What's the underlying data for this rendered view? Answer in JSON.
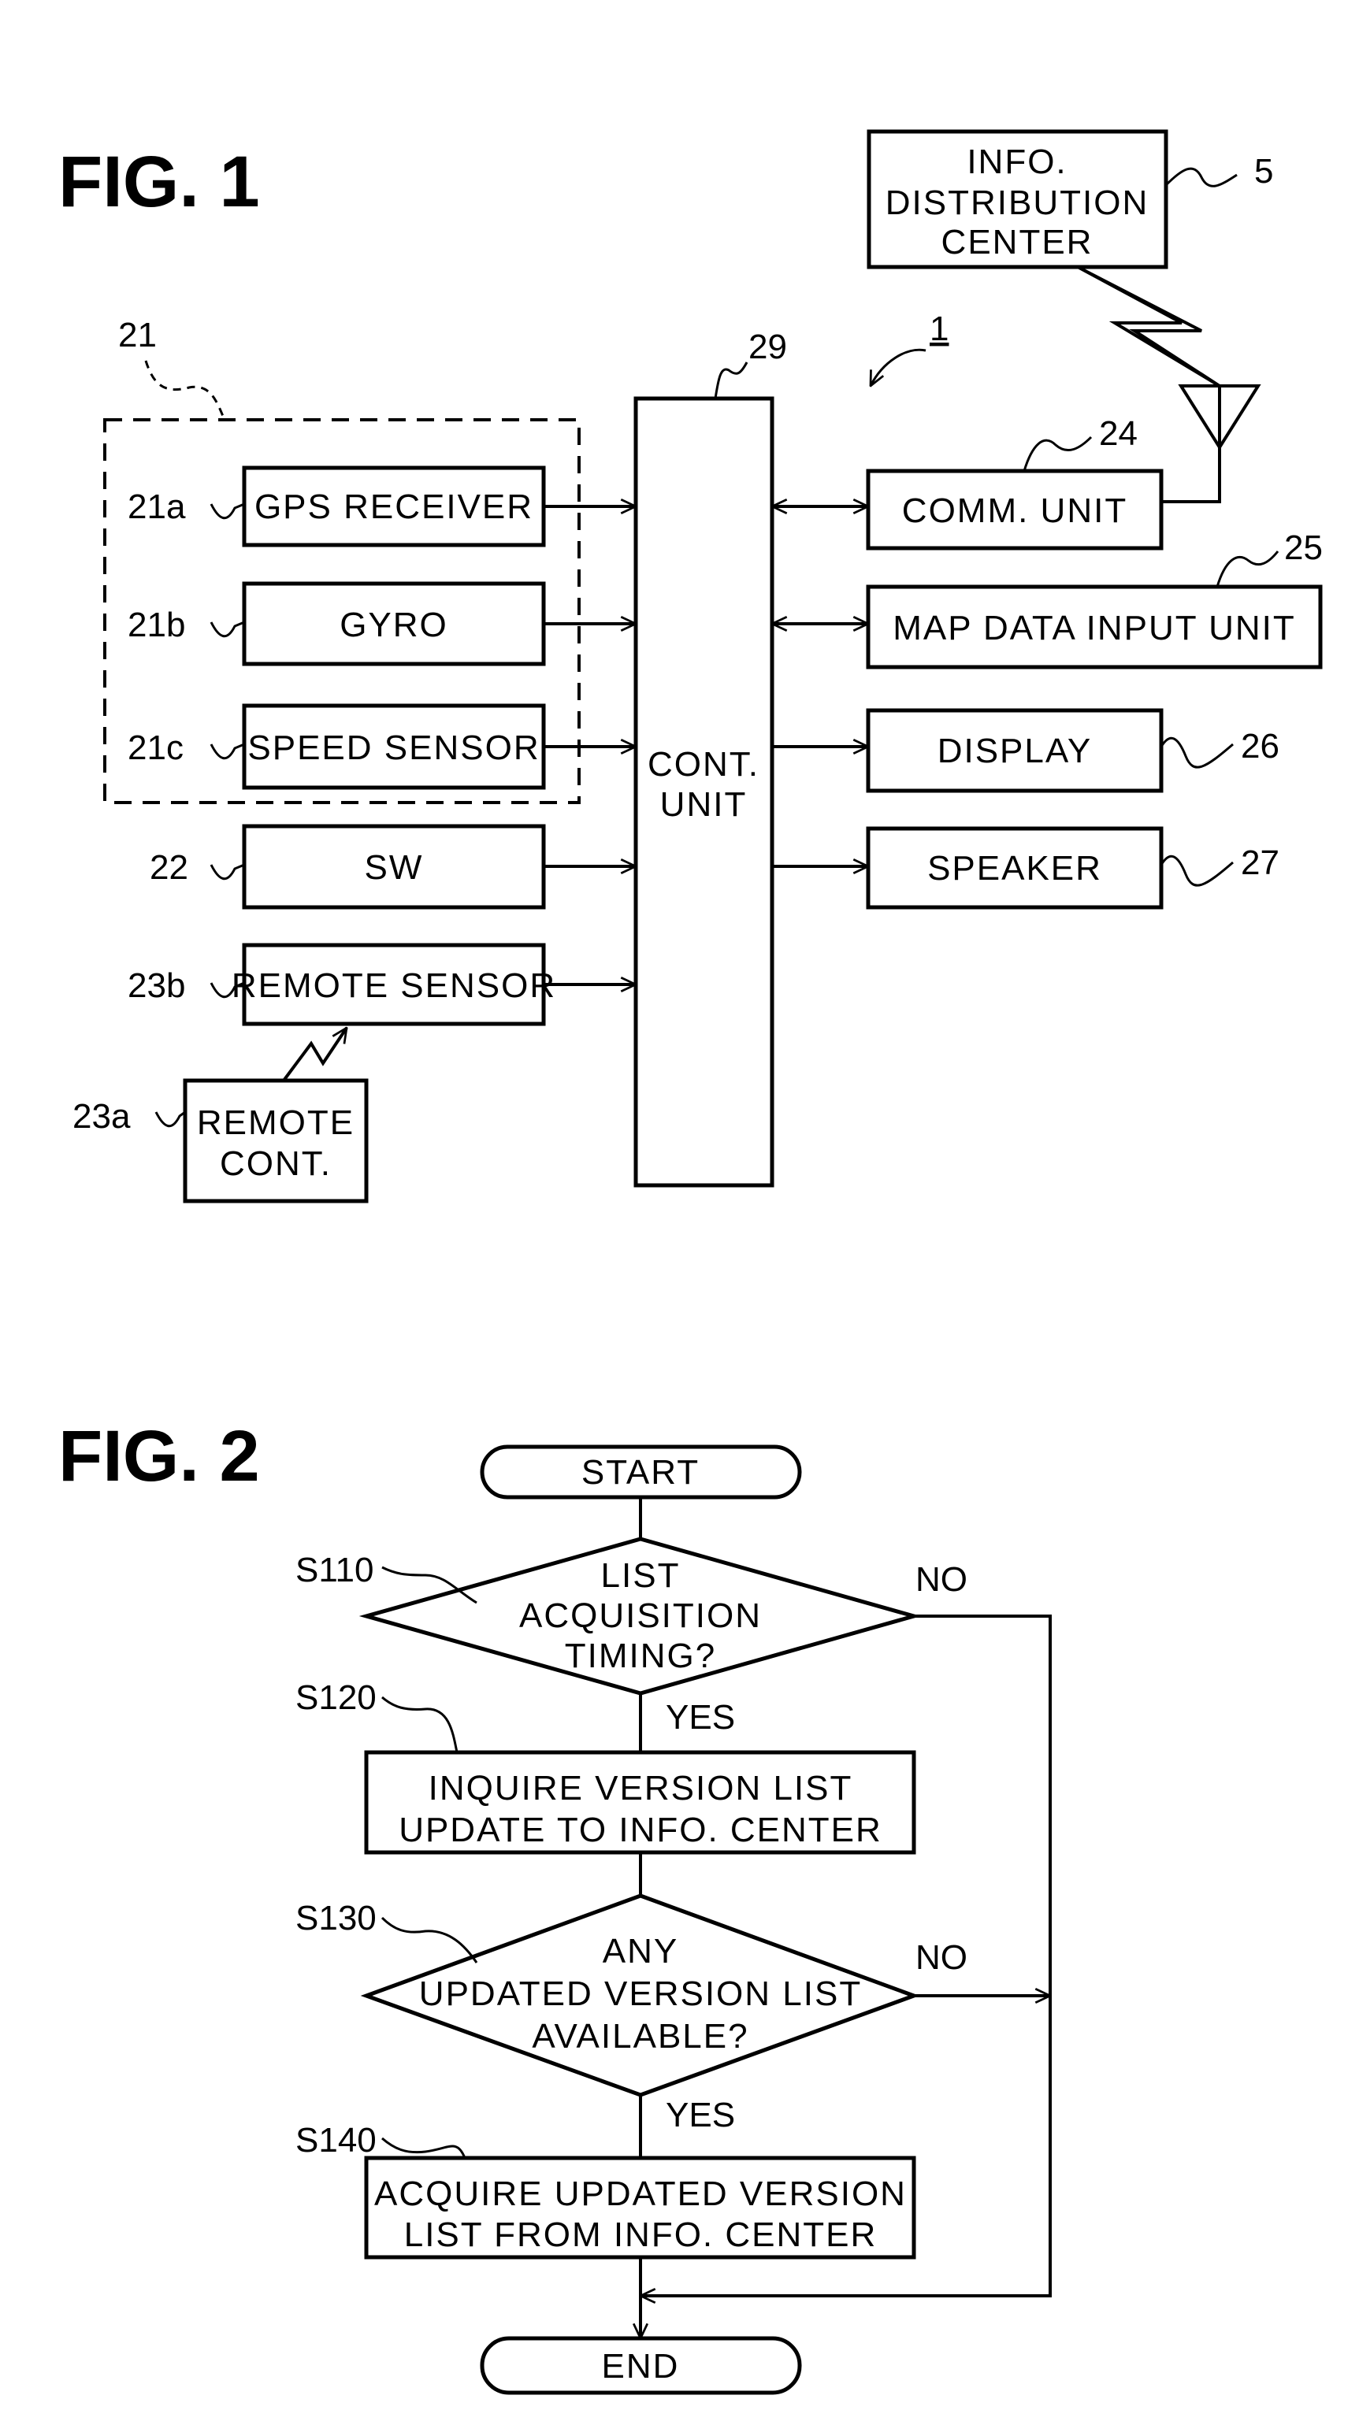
{
  "fig1": {
    "title": "FIG. 1",
    "system_ref": "1",
    "info_center": {
      "lines": [
        "INFO.",
        "DISTRIBUTION",
        "CENTER"
      ],
      "ref": "5"
    },
    "sensor_group_ref": "21",
    "gps": {
      "label": "GPS RECEIVER",
      "ref": "21a"
    },
    "gyro": {
      "label": "GYRO",
      "ref": "21b"
    },
    "speed": {
      "label": "SPEED SENSOR",
      "ref": "21c"
    },
    "sw": {
      "label": "SW",
      "ref": "22"
    },
    "remote_sensor": {
      "label": "REMOTE SENSOR",
      "ref": "23b"
    },
    "remote_cont": {
      "lines": [
        "REMOTE",
        "CONT."
      ],
      "ref": "23a"
    },
    "cont_unit": {
      "lines": [
        "CONT.",
        "UNIT"
      ],
      "ref": "29"
    },
    "comm_unit": {
      "label": "COMM. UNIT",
      "ref": "24"
    },
    "map_input": {
      "label": "MAP DATA INPUT UNIT",
      "ref": "25"
    },
    "display": {
      "label": "DISPLAY",
      "ref": "26"
    },
    "speaker": {
      "label": "SPEAKER",
      "ref": "27"
    }
  },
  "fig2": {
    "title": "FIG. 2",
    "start": "START",
    "end": "END",
    "s110": {
      "ref": "S110",
      "lines": [
        "LIST",
        "ACQUISITION",
        "TIMING?"
      ],
      "yes": "YES",
      "no": "NO"
    },
    "s120": {
      "ref": "S120",
      "lines": [
        "INQUIRE VERSION LIST",
        "UPDATE TO INFO. CENTER"
      ]
    },
    "s130": {
      "ref": "S130",
      "lines": [
        "ANY",
        "UPDATED VERSION LIST",
        "AVAILABLE?"
      ],
      "yes": "YES",
      "no": "NO"
    },
    "s140": {
      "ref": "S140",
      "lines": [
        "ACQUIRE UPDATED VERSION",
        "LIST FROM INFO. CENTER"
      ]
    }
  }
}
